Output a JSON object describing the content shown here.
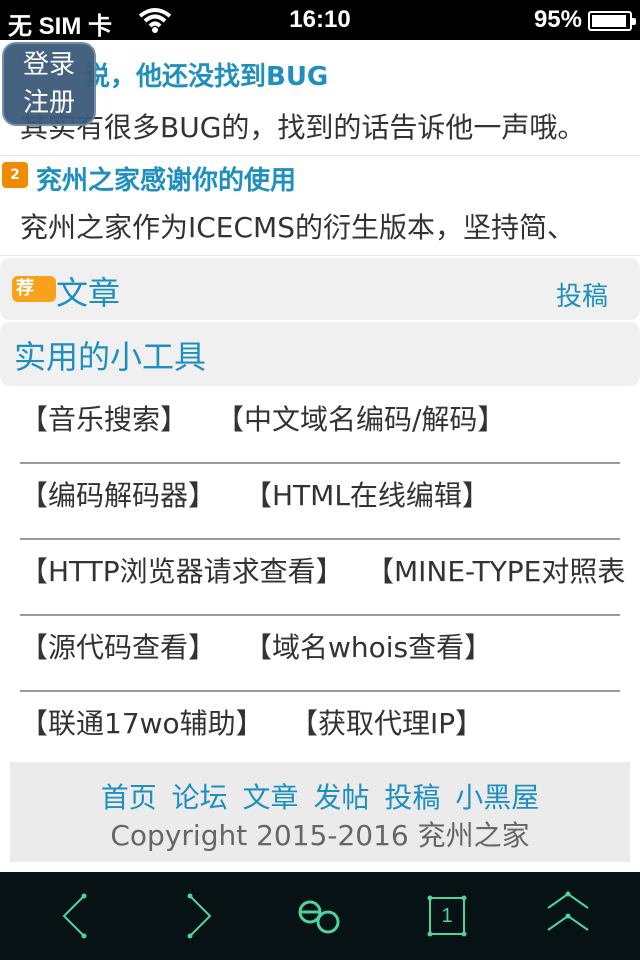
{
  "status_bar": {
    "carrier": "无 SIM 卡",
    "time": "16:10",
    "battery_percent_text": "95%",
    "battery_level": 0.95
  },
  "login": {
    "login_label": "登录",
    "register_label": "注册"
  },
  "news": [
    {
      "title": "说，他还没找到BUG",
      "desc": "其实有很多BUG的，找到的话告诉他一声哦。"
    },
    {
      "rank": "2",
      "title": "兖州之家感谢你的使用",
      "desc": "兖州之家作为ICECMS的衍生版本，坚持简、"
    }
  ],
  "articles_section": {
    "badge": "荐",
    "title": "文章",
    "submit_label": "投稿"
  },
  "tools_section": {
    "title": "实用的小工具",
    "rows": [
      [
        "【音乐搜索】",
        "【中文域名编码/解码】"
      ],
      [
        "【编码解码器】",
        "【HTML在线编辑】"
      ],
      [
        "【HTTP浏览器请求查看】",
        "【MINE-TYPE对照表"
      ],
      [
        "【源代码查看】",
        "【域名whois查看】"
      ],
      [
        "【联通17wo辅助】",
        "【获取代理IP】"
      ]
    ]
  },
  "footer": {
    "links": [
      "首页",
      "论坛",
      "文章",
      "发帖",
      "投稿",
      "小黑屋"
    ],
    "copyright": "Copyright 2015-2016 兖州之家"
  },
  "toolbar": {
    "tab_count": "1",
    "icons": [
      "back-icon",
      "forward-icon",
      "menu-icon",
      "tabs-icon",
      "scroll-top-icon"
    ],
    "accent_color": "#4fd29f"
  }
}
